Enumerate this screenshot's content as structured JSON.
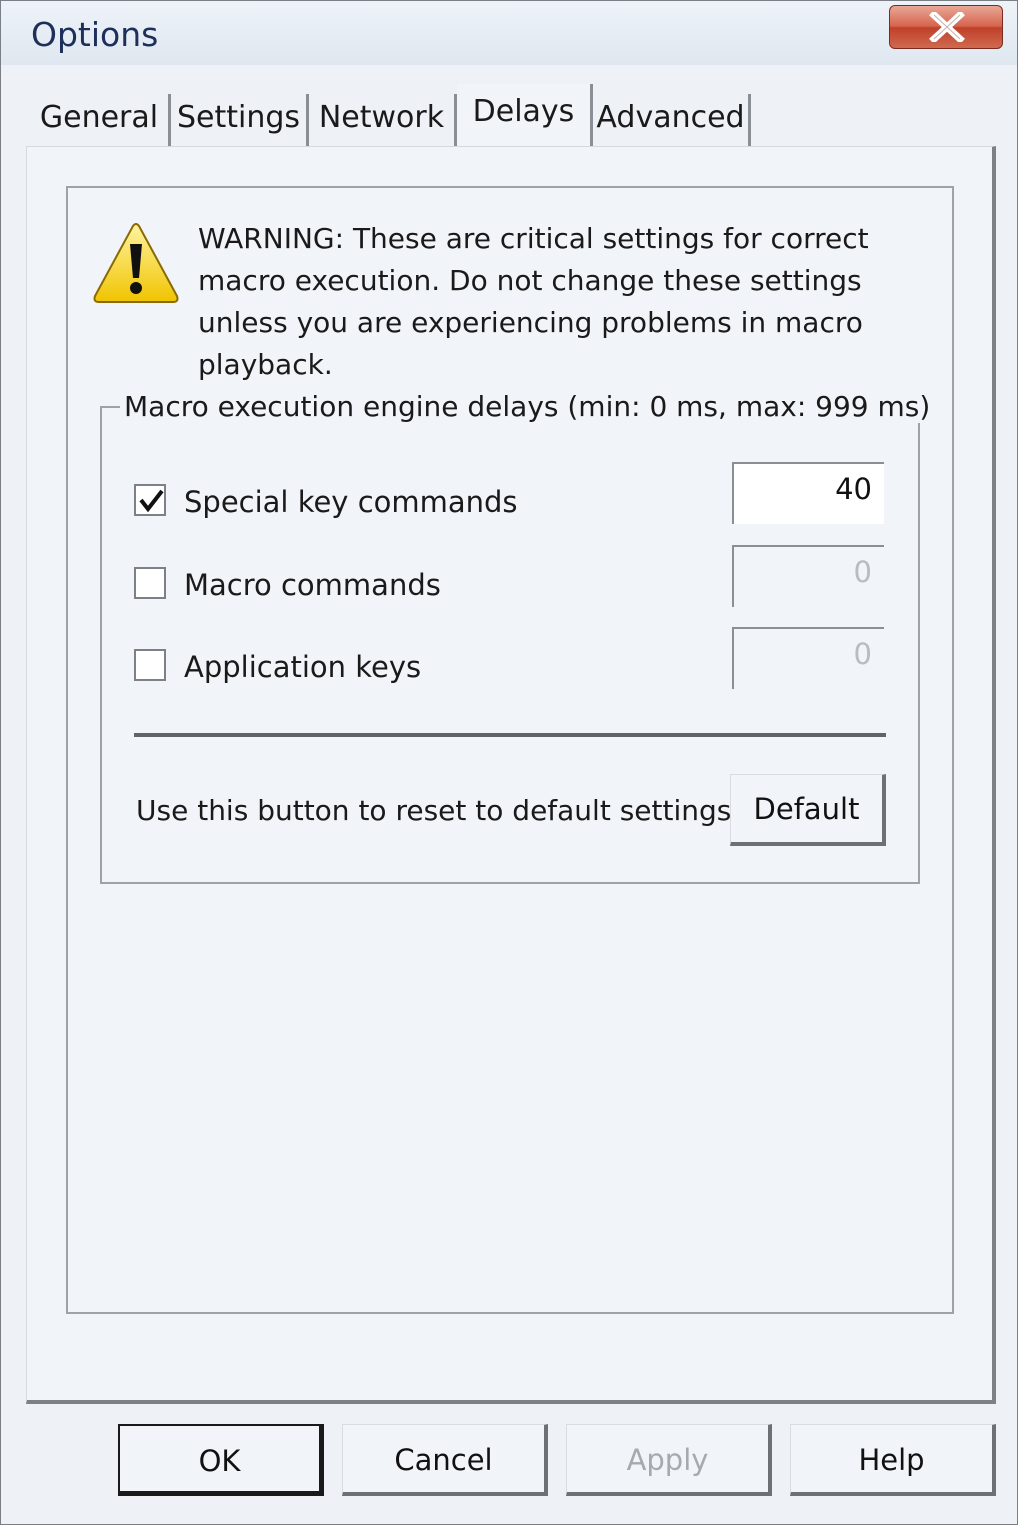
{
  "window": {
    "title": "Options",
    "close_icon": "close-icon"
  },
  "tabs": [
    {
      "label": "General",
      "active": false
    },
    {
      "label": "Settings",
      "active": false
    },
    {
      "label": "Network",
      "active": false
    },
    {
      "label": "Delays",
      "active": true
    },
    {
      "label": "Advanced",
      "active": false
    }
  ],
  "warning": {
    "icon": "warning-icon",
    "text": "WARNING: These are critical settings for correct macro execution. Do not change these settings unless you are experiencing problems in macro playback."
  },
  "delays_group": {
    "legend": "Macro execution engine delays (min: 0 ms, max: 999 ms)",
    "rows": [
      {
        "label": "Special key commands",
        "checked": true,
        "value": "40",
        "enabled": true
      },
      {
        "label": "Macro commands",
        "checked": false,
        "value": "0",
        "enabled": false
      },
      {
        "label": "Application keys",
        "checked": false,
        "value": "0",
        "enabled": false
      }
    ],
    "reset_text": "Use this button to reset to default settings",
    "default_label": "Default"
  },
  "buttons": {
    "ok": "OK",
    "cancel": "Cancel",
    "apply": "Apply",
    "help": "Help"
  }
}
